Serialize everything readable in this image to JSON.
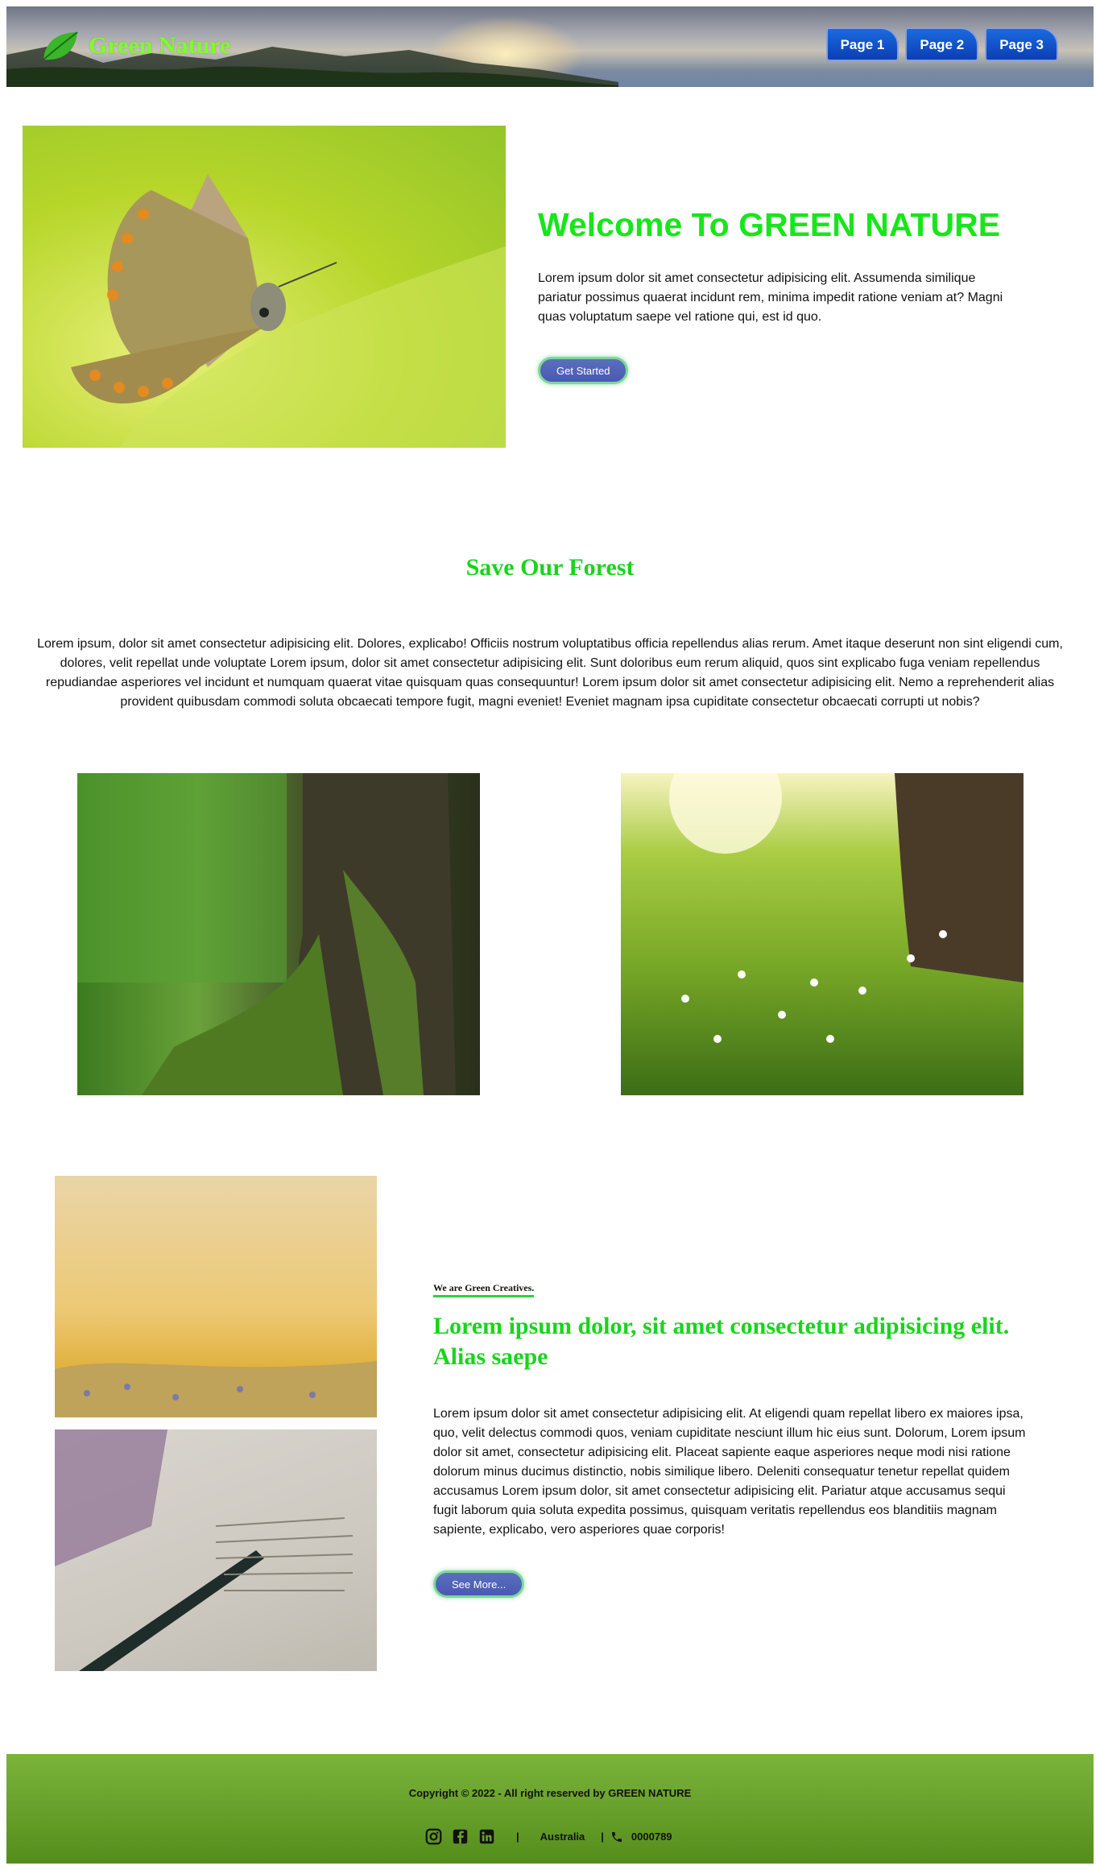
{
  "header": {
    "brand": "Green Nature",
    "nav": [
      "Page 1",
      "Page 2",
      "Page 3"
    ],
    "logo_icon": "leaf-icon"
  },
  "hero": {
    "title": "Welcome To GREEN NATURE",
    "text": "Lorem ipsum dolor sit amet consectetur adipisicing elit. Assumenda similique pariatur possimus quaerat incidunt rem, minima impedit ratione veniam at? Magni quas voluptatum saepe vel ratione qui, est id quo.",
    "button": "Get Started"
  },
  "forest": {
    "title": "Save Our Forest",
    "text": "Lorem ipsum, dolor sit amet consectetur adipisicing elit. Dolores, explicabo! Officiis nostrum voluptatibus officia repellendus alias rerum. Amet itaque deserunt non sint eligendi cum, dolores, velit repellat unde voluptate Lorem ipsum, dolor sit amet consectetur adipisicing elit. Sunt doloribus eum rerum aliquid, quos sint explicabo fuga veniam repellendus repudiandae asperiores vel incidunt et numquam quaerat vitae quisquam quas consequuntur! Lorem ipsum dolor sit amet consectetur adipisicing elit. Nemo a reprehenderit alias provident quibusdam commodi soluta obcaecati tempore fugit, magni eveniet! Eveniet magnam ipsa cupiditate consectetur obcaecati corrupti ut nobis?"
  },
  "creatives": {
    "kicker": "We are Green Creatives.",
    "title": "Lorem ipsum dolor, sit amet consectetur adipisicing elit. Alias saepe",
    "text": "Lorem ipsum dolor sit amet consectetur adipisicing elit. At eligendi quam repellat libero ex maiores ipsa, quo, velit delectus commodi quos, veniam cupiditate nesciunt illum hic eius sunt. Dolorum, Lorem ipsum dolor sit amet, consectetur adipisicing elit. Placeat sapiente eaque asperiores neque modi nisi ratione dolorum minus ducimus distinctio, nobis similique libero. Deleniti consequatur tenetur repellat quidem accusamus Lorem ipsum dolor, sit amet consectetur adipisicing elit. Pariatur atque accusamus sequi fugit laborum quia soluta expedita possimus, quisquam veritatis repellendus eos blanditiis magnam sapiente, explicabo, vero asperiores quae corporis!",
    "button": "See More..."
  },
  "footer": {
    "copyright": "Copyright © 2022 - All right reserved by GREEN NATURE",
    "social_icons": [
      "instagram-icon",
      "facebook-icon",
      "linkedin-icon"
    ],
    "separator": "|",
    "location": "Australia",
    "phone_icon": "phone-icon",
    "phone": "0000789"
  },
  "colors": {
    "accent_green": "#19d41d",
    "brand_green": "#7fff2a",
    "nav_blue": "#0b3eb4",
    "footer_green": "#6aa22a"
  }
}
